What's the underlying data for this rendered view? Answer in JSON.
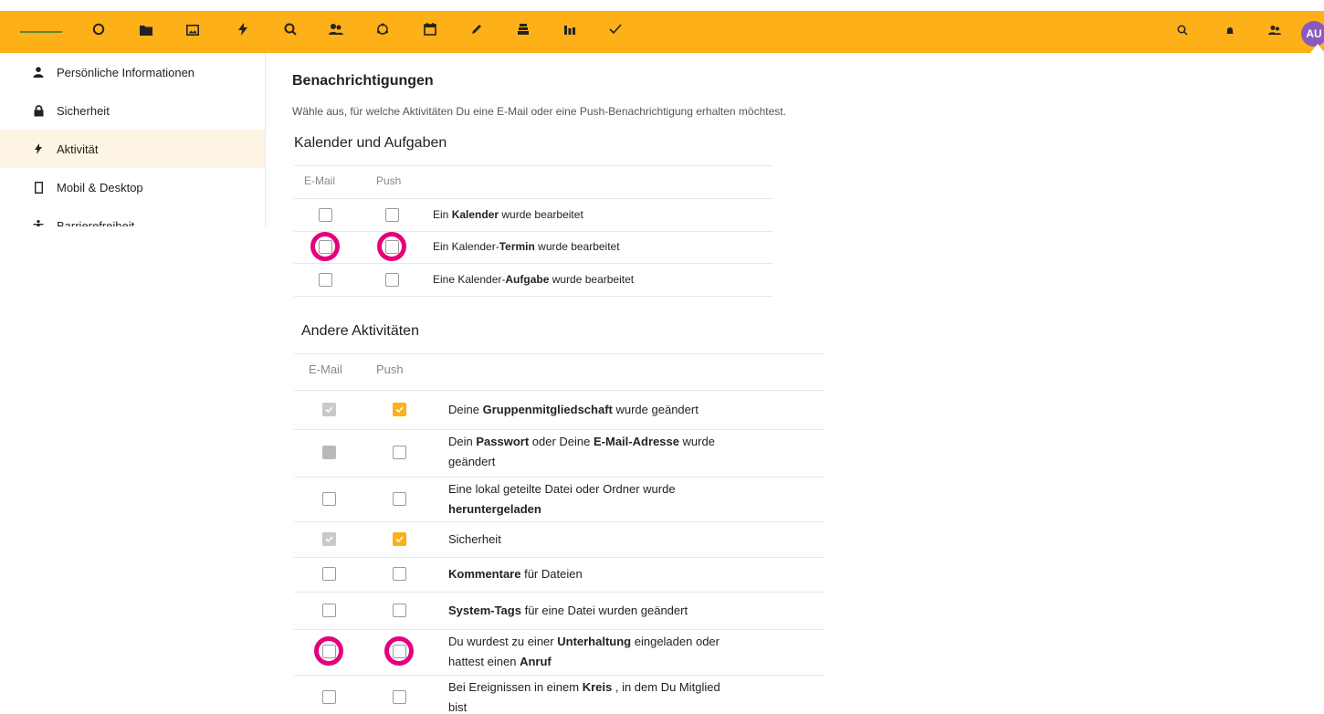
{
  "header": {
    "avatar_text": "AU",
    "app_icons": [
      "dashboard-icon",
      "files-icon",
      "photos-icon",
      "activity-icon",
      "search-app-icon",
      "contacts-icon",
      "circles-icon",
      "calendar-icon",
      "notes-icon",
      "deck-icon",
      "analytics-icon",
      "tasks-icon"
    ],
    "right_icons": [
      "search-icon",
      "notifications-icon",
      "contacts-menu-icon"
    ],
    "accent": "#FDB017"
  },
  "sidebar": {
    "items": [
      {
        "label": "Persönliche Informationen",
        "icon": "person-icon"
      },
      {
        "label": "Sicherheit",
        "icon": "lock-icon"
      },
      {
        "label": "Aktivität",
        "icon": "activity-icon",
        "active": true
      },
      {
        "label": "Mobil & Desktop",
        "icon": "phone-icon"
      },
      {
        "label": "Barrierefreiheit",
        "icon": "accessibility-icon"
      }
    ]
  },
  "main": {
    "title": "Benachrichtigungen",
    "description": "Wähle aus, für welche Aktivitäten Du eine E-Mail oder eine Push-Benachrichtigung erhalten möchtest.",
    "col_email": "E-Mail",
    "col_push": "Push",
    "calendar_section": {
      "title": "Kalender und Aufgaben",
      "rows": [
        {
          "parts": [
            "Ein ",
            "Kalender",
            " wurde bearbeitet"
          ],
          "email": "unchecked",
          "push": "unchecked"
        },
        {
          "parts": [
            "Ein Kalender-",
            "Termin",
            " wurde bearbeitet"
          ],
          "email": "unchecked",
          "push": "unchecked",
          "highlighted": true
        },
        {
          "parts": [
            "Eine Kalender-",
            "Aufgabe",
            " wurde bearbeitet"
          ],
          "email": "unchecked",
          "push": "unchecked"
        }
      ]
    },
    "other_section": {
      "title": "Andere Aktivitäten",
      "rows": [
        {
          "line1": [
            "Deine ",
            "Gruppenmitgliedschaft",
            " wurde geändert"
          ],
          "line2": [],
          "email": "checked-gray",
          "push": "checked-orange"
        },
        {
          "line1": [
            "Dein ",
            "Passwort",
            " oder Deine ",
            "E-Mail-Adresse",
            " wurde"
          ],
          "line2": [
            "geändert"
          ],
          "email": "filled-gray",
          "push": "unchecked"
        },
        {
          "line1": [
            "Eine lokal geteilte Datei oder Ordner wurde"
          ],
          "line2": [
            "",
            "heruntergeladen"
          ],
          "email": "unchecked",
          "push": "unchecked"
        },
        {
          "line1": [
            "Sicherheit"
          ],
          "line2": [],
          "email": "checked-gray",
          "push": "checked-orange"
        },
        {
          "line1": [
            "",
            "Kommentare",
            " für Dateien"
          ],
          "line2": [],
          "email": "unchecked",
          "push": "unchecked"
        },
        {
          "line1": [
            "",
            "System-Tags",
            " für eine Datei wurden geändert"
          ],
          "line2": [],
          "email": "unchecked",
          "push": "unchecked"
        },
        {
          "line1": [
            "Du wurdest zu einer ",
            "Unterhaltung",
            " eingeladen oder"
          ],
          "line2": [
            "hattest einen ",
            "Anruf"
          ],
          "email": "unchecked",
          "push": "unchecked",
          "highlighted": true
        },
        {
          "line1": [
            "Bei Ereignissen in einem ",
            "Kreis",
            " , in dem Du Mitglied"
          ],
          "line2": [
            "bist"
          ],
          "email": "unchecked",
          "push": "unchecked"
        }
      ]
    }
  }
}
